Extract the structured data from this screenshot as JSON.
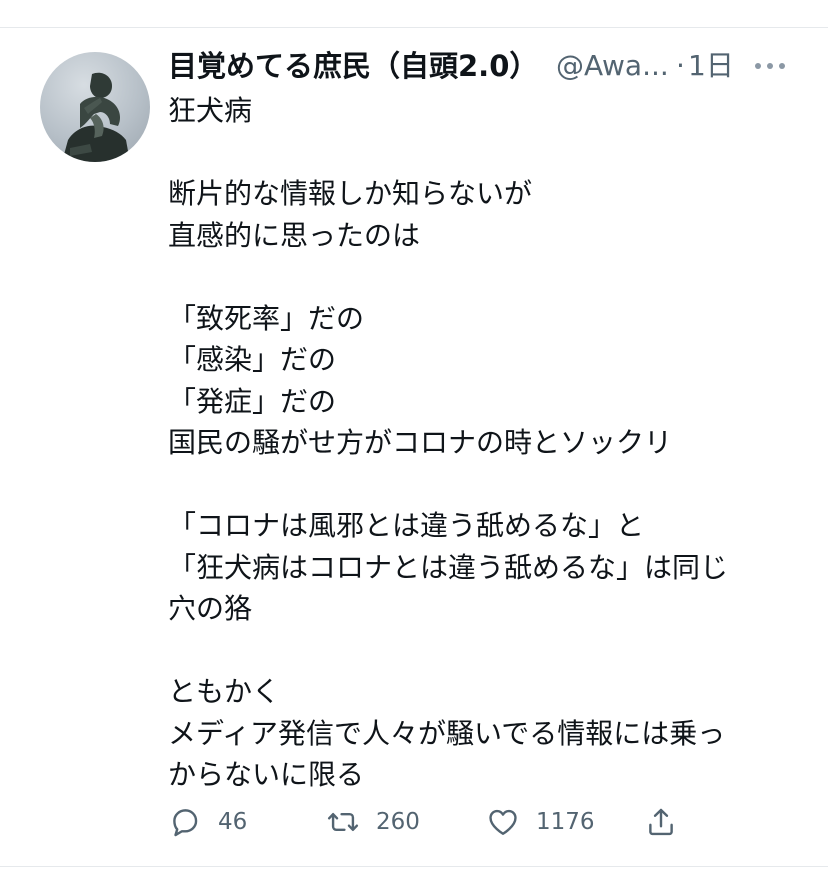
{
  "tweet": {
    "display_name": "目覚めてる庶民（自頭2.0）",
    "handle": "@Awa...",
    "separator": "·",
    "time": "1日",
    "more_icon": "more-horizontal-icon",
    "avatar_icon": "thinker-statue-avatar",
    "lines": [
      "狂犬病",
      "",
      "断片的な情報しか知らないが",
      "直感的に思ったのは",
      "",
      "「致死率」だの",
      "「感染」だの",
      "「発症」だの",
      "国民の騒がせ方がコロナの時とソックリ",
      "",
      "「コロナは風邪とは違う舐めるな」と",
      "「狂犬病はコロナとは違う舐めるな」は同じ",
      "穴の狢",
      "",
      "ともかく",
      "メディア発信で人々が騒いでる情報には乗っ",
      "からないに限る"
    ],
    "actions": {
      "reply": {
        "icon": "reply-icon",
        "count": "46"
      },
      "retweet": {
        "icon": "retweet-icon",
        "count": "260"
      },
      "like": {
        "icon": "heart-icon",
        "count": "1176"
      },
      "share": {
        "icon": "share-icon"
      }
    }
  },
  "colors": {
    "text_primary": "#0f1419",
    "text_secondary": "#536471",
    "divider": "#e6e9ec"
  }
}
